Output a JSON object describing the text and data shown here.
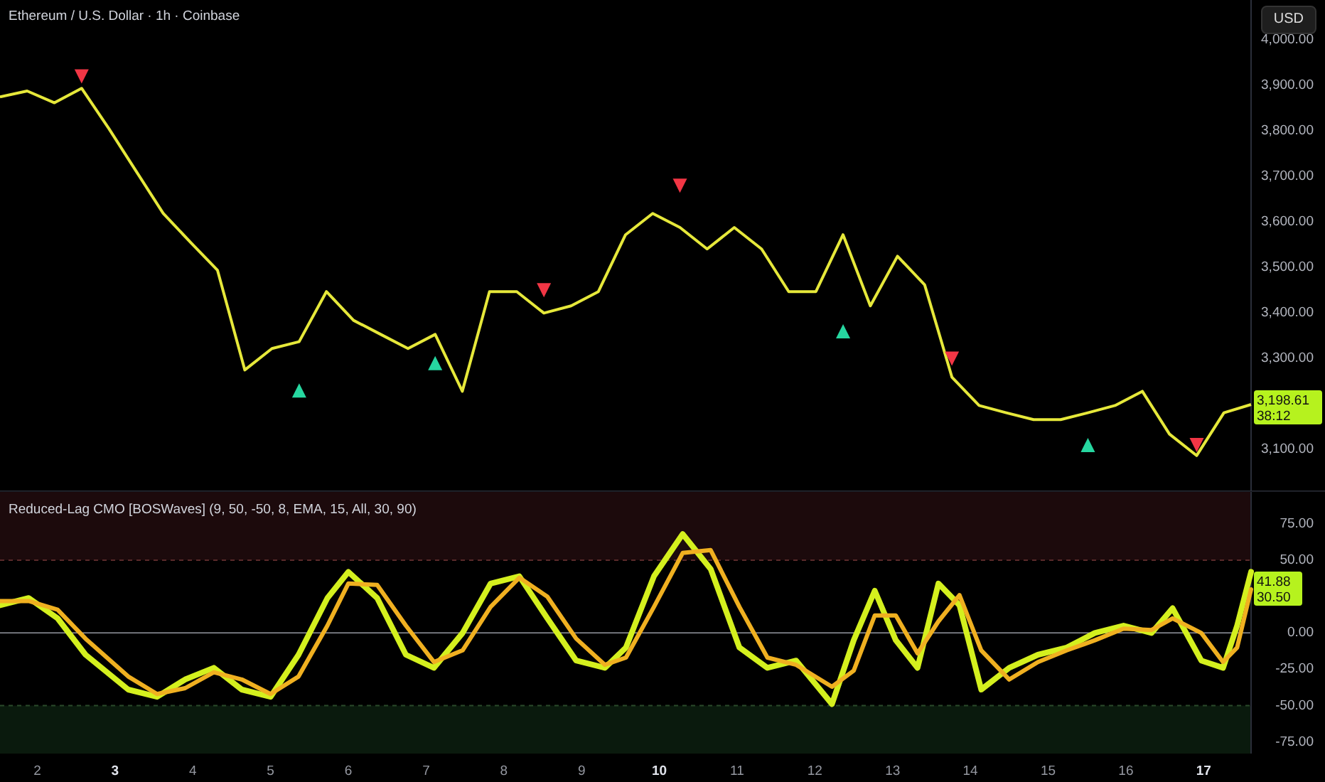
{
  "header": {
    "title": "Ethereum / U.S. Dollar · 1h · Coinbase",
    "currency_button": "USD"
  },
  "price_pane": {
    "last_price": "3,198.61",
    "countdown": "38:12",
    "chart_data": {
      "type": "line",
      "ylim": [
        3010,
        4088
      ],
      "series": [
        {
          "color": "#e6e83a",
          "values": [
            3875,
            3888,
            3862,
            3894,
            3806,
            3712,
            3619,
            3556,
            3494,
            3275,
            3322,
            3337,
            3447,
            3384,
            3353,
            3322,
            3353,
            3228,
            3447,
            3447,
            3400,
            3416,
            3447,
            3572,
            3619,
            3588,
            3541,
            3588,
            3541,
            3447,
            3447,
            3572,
            3416,
            3525,
            3462,
            3259,
            3197,
            3181,
            3166,
            3166,
            3181,
            3197,
            3228,
            3134,
            3087,
            3181,
            3199
          ]
        },
        {
          "type": "scatter",
          "color": "#f23645",
          "values": [
            null,
            null,
            null,
            3920,
            null,
            null,
            null,
            null,
            null,
            null,
            null,
            null,
            null,
            null,
            null,
            null,
            null,
            null,
            null,
            null,
            3450,
            null,
            null,
            null,
            null,
            3680,
            null,
            null,
            null,
            null,
            null,
            null,
            null,
            null,
            null,
            3300,
            null,
            null,
            null,
            null,
            null,
            null,
            null,
            null,
            3110,
            null,
            null
          ]
        },
        {
          "type": "scatter",
          "color": "#26d7a0",
          "values": [
            null,
            null,
            null,
            null,
            null,
            null,
            null,
            null,
            null,
            null,
            null,
            3230,
            null,
            null,
            null,
            null,
            3290,
            null,
            null,
            null,
            null,
            null,
            null,
            null,
            null,
            null,
            null,
            null,
            null,
            null,
            null,
            3360,
            null,
            null,
            null,
            null,
            null,
            null,
            null,
            null,
            3110,
            null,
            null,
            null,
            null,
            null,
            null
          ]
        }
      ],
      "yticks": [
        {
          "value": 4000,
          "label": "4,000.00"
        },
        {
          "value": 3900,
          "label": "3,900.00"
        },
        {
          "value": 3800,
          "label": "3,800.00"
        },
        {
          "value": 3700,
          "label": "3,700.00"
        },
        {
          "value": 3600,
          "label": "3,600.00"
        },
        {
          "value": 3500,
          "label": "3,500.00"
        },
        {
          "value": 3400,
          "label": "3,400.00"
        },
        {
          "value": 3300,
          "label": "3,300.00"
        },
        {
          "value": 3100,
          "label": "3,100.00"
        }
      ]
    }
  },
  "indicator_pane": {
    "title": "Reduced-Lag CMO [BOSWaves] (9, 50, -50, 8, EMA, 15, All, 30, 90)",
    "values": [
      "41.88",
      "30.50"
    ],
    "chart_data": {
      "type": "line",
      "ylim": [
        -83,
        97
      ],
      "xlim": [
        1.52,
        17.61
      ],
      "x": [
        1.52,
        1.89,
        2.26,
        2.62,
        3.17,
        3.54,
        3.9,
        4.27,
        4.63,
        5.0,
        5.36,
        5.73,
        6.0,
        6.37,
        6.74,
        7.1,
        7.47,
        7.83,
        8.2,
        8.56,
        8.93,
        9.3,
        9.57,
        9.93,
        10.3,
        10.66,
        11.03,
        11.39,
        11.76,
        12.22,
        12.5,
        12.77,
        13.04,
        13.32,
        13.59,
        13.86,
        14.14,
        14.5,
        14.87,
        15.24,
        15.6,
        15.97,
        16.33,
        16.6,
        16.97,
        17.25,
        17.43,
        17.61
      ],
      "series": [
        {
          "color": "#d4f01e",
          "values": [
            19,
            24,
            10,
            -15,
            -39,
            -44,
            -32,
            -24,
            -39,
            -44,
            -15,
            24,
            42,
            24,
            -15,
            -24,
            0,
            34,
            39,
            10,
            -19,
            -24,
            -10,
            39,
            68,
            44,
            -10,
            -24,
            -19,
            -49,
            -5,
            29,
            -5,
            -24,
            34,
            19,
            -39,
            -24,
            -15,
            -10,
            0,
            5,
            0,
            17,
            -19,
            -24,
            5,
            42
          ]
        },
        {
          "color": "#f0b020",
          "values": [
            22,
            22,
            16,
            -4,
            -30,
            -42,
            -38,
            -27,
            -32,
            -42,
            -30,
            5,
            34,
            33,
            5,
            -20,
            -12,
            18,
            38,
            25,
            -4,
            -22,
            -17,
            18,
            55,
            57,
            18,
            -17,
            -22,
            -37,
            -26,
            12,
            12,
            -14,
            8,
            26,
            -12,
            -32,
            -20,
            -12,
            -5,
            3,
            2,
            10,
            0,
            -20,
            -10,
            30
          ]
        }
      ],
      "xticks": [
        {
          "value": 2,
          "label": "2"
        },
        {
          "value": 3,
          "label": "3"
        },
        {
          "value": 4,
          "label": "4"
        },
        {
          "value": 5,
          "label": "5"
        },
        {
          "value": 6,
          "label": "6"
        },
        {
          "value": 7,
          "label": "7"
        },
        {
          "value": 8,
          "label": "8"
        },
        {
          "value": 9,
          "label": "9"
        },
        {
          "value": 10,
          "label": "10"
        },
        {
          "value": 11,
          "label": "11"
        },
        {
          "value": 12,
          "label": "12"
        },
        {
          "value": 13,
          "label": "13"
        },
        {
          "value": 14,
          "label": "14"
        },
        {
          "value": 15,
          "label": "15"
        },
        {
          "value": 16,
          "label": "16"
        },
        {
          "value": 17,
          "label": "17"
        }
      ],
      "yticks": [
        {
          "value": 75,
          "label": "75.00"
        },
        {
          "value": 50,
          "label": "50.00"
        },
        {
          "value": 0,
          "label": "0.00"
        },
        {
          "value": -25,
          "label": "-25.00"
        },
        {
          "value": -50,
          "label": "-50.00"
        },
        {
          "value": -75,
          "label": "-75.00"
        }
      ],
      "ref_lines": [
        {
          "axis": "y",
          "value": 50
        },
        {
          "axis": "y",
          "value": 0
        },
        {
          "axis": "y",
          "value": -50
        }
      ]
    }
  },
  "time_axis": {
    "ticks": [
      {
        "bold": false
      },
      {
        "bold": true
      },
      {
        "bold": false
      },
      {
        "bold": false
      },
      {
        "bold": false
      },
      {
        "bold": false
      },
      {
        "bold": false
      },
      {
        "bold": false
      },
      {
        "bold": true
      },
      {
        "bold": false
      },
      {
        "bold": false
      },
      {
        "bold": false
      },
      {
        "bold": false
      },
      {
        "bold": false
      },
      {
        "bold": false
      },
      {
        "bold": true
      }
    ]
  }
}
